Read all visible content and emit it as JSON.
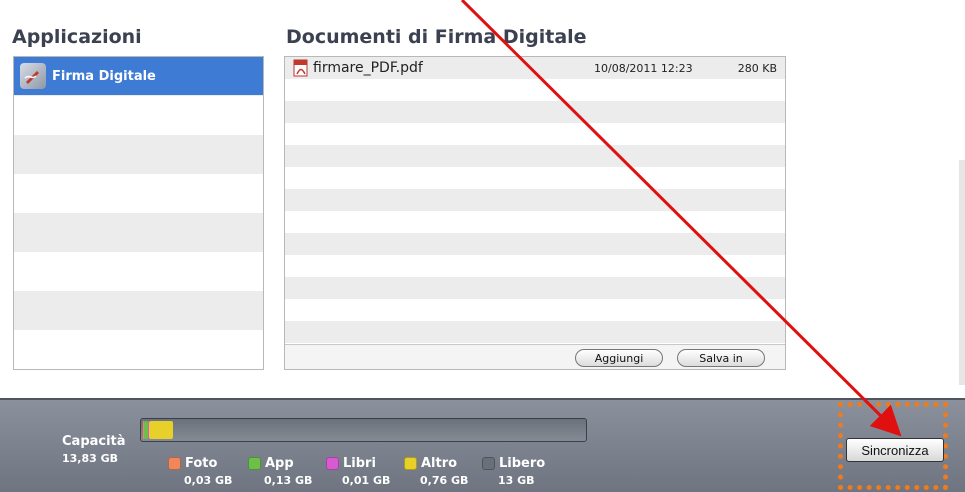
{
  "applications": {
    "heading": "Applicazioni",
    "items": [
      {
        "label": "Firma Digitale",
        "selected": true,
        "icon": "signature-pen-icon"
      }
    ]
  },
  "documents": {
    "heading": "Documenti di Firma Digitale",
    "files": [
      {
        "name": "firmare_PDF.pdf",
        "date": "10/08/2011 12:23",
        "size": "280 KB",
        "icon": "pdf-file-icon"
      }
    ],
    "add_label": "Aggiungi",
    "save_in_label": "Salva in"
  },
  "capacity": {
    "label": "Capacità",
    "total": "13,83 GB",
    "legend": [
      {
        "name": "Foto",
        "value": "0,03 GB",
        "color": "#f0875a",
        "fraction": 0.002
      },
      {
        "name": "App",
        "value": "0,13 GB",
        "color": "#6cc04a",
        "fraction": 0.009
      },
      {
        "name": "Libri",
        "value": "0,01 GB",
        "color": "#d65bd0",
        "fraction": 0.001
      },
      {
        "name": "Altro",
        "value": "0,76 GB",
        "color": "#e8d02a",
        "fraction": 0.055
      },
      {
        "name": "Libero",
        "value": "13 GB",
        "color": "#6a707a",
        "fraction": 0.933
      }
    ]
  },
  "sync": {
    "label": "Sincronizza"
  },
  "colors": {
    "selection": "#3d7bd4",
    "highlight_frame": "#f07a1e",
    "arrow": "#e01010"
  }
}
